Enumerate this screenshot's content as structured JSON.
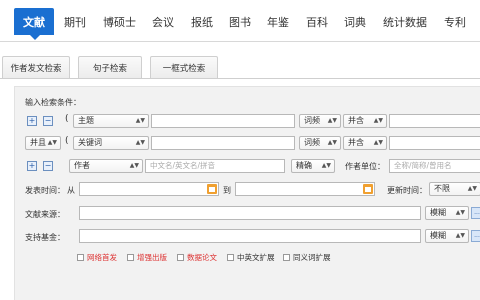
{
  "nav": {
    "items": [
      "文献",
      "期刊",
      "博硕士",
      "会议",
      "报纸",
      "图书",
      "年鉴",
      "百科",
      "词典",
      "统计数据",
      "专利"
    ],
    "active_index": 0
  },
  "subtabs": [
    "作者发文检索",
    "句子检索",
    "一框式检索"
  ],
  "form": {
    "heading": "输入检索条件：",
    "row1": {
      "field": "主题",
      "match": "词频",
      "logic": "并含"
    },
    "row2": {
      "bool": "并且",
      "field": "关键词",
      "match": "词频",
      "logic": "并含"
    },
    "row3": {
      "field": "作者",
      "placeholder": "中文名/英文名/拼音",
      "match": "精确",
      "unit_label": "作者单位：",
      "unit_placeholder": "全称/简称/曾用名"
    },
    "row4": {
      "label": "发表时间：",
      "from": "从",
      "to": "到",
      "update_label": "更新时间：",
      "update_value": "不限"
    },
    "row5": {
      "label": "文献来源：",
      "match": "模糊"
    },
    "row6": {
      "label": "支持基金：",
      "match": "模糊"
    },
    "checkboxes": [
      {
        "label": "网络首发",
        "color": "#d33"
      },
      {
        "label": "增强出版",
        "color": "#d33"
      },
      {
        "label": "数据论文",
        "color": "#d33"
      },
      {
        "label": "中英文扩展",
        "color": "#333"
      },
      {
        "label": "同义词扩展",
        "color": "#333"
      }
    ],
    "plus_icon": "plus-icon",
    "minus_icon": "minus-icon",
    "dots_label": "..."
  },
  "colors": {
    "accent": "#1a6fd1",
    "panel": "#f2f2f2"
  }
}
